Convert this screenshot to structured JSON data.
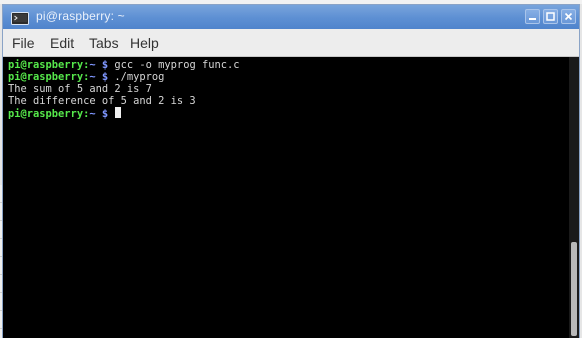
{
  "window": {
    "title": "pi@raspberry: ~",
    "icon": "terminal-icon"
  },
  "controls": {
    "minimize_icon": "minimize-icon",
    "maximize_icon": "maximize-icon",
    "close_icon": "close-icon"
  },
  "menu": {
    "items": [
      {
        "label": "File"
      },
      {
        "label": "Edit"
      },
      {
        "label": "Tabs"
      },
      {
        "label": "Help"
      }
    ]
  },
  "terminal": {
    "lines": [
      {
        "prompt": "pi@raspberry:",
        "path": "~",
        "symbol": " $ ",
        "command": "gcc -o myprog func.c"
      },
      {
        "prompt": "pi@raspberry:",
        "path": "~",
        "symbol": " $ ",
        "command": "./myprog"
      },
      {
        "output": "The sum of 5 and 2 is 7"
      },
      {
        "output": "The difference of 5 and 2 is 3"
      },
      {
        "prompt": "pi@raspberry:",
        "path": "~",
        "symbol": " $ ",
        "command": ""
      }
    ]
  },
  "colors": {
    "titlebar": "#5d8fd3",
    "prompt": "#56e84b",
    "path": "#7f97ff",
    "text": "#d6d6d6",
    "background": "#000000"
  }
}
